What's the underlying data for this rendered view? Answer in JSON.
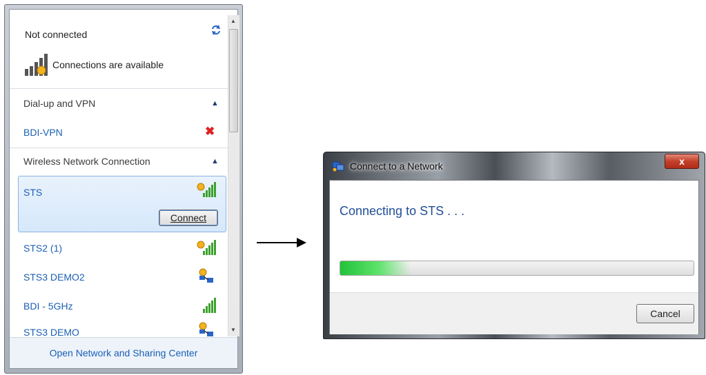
{
  "flyout": {
    "status_title": "Not connected",
    "status_subtitle": "Connections are available",
    "sections": {
      "dialup": {
        "label": "Dial-up and VPN",
        "items": [
          {
            "name": "BDI-VPN",
            "icon": "red-x-icon"
          }
        ]
      },
      "wireless": {
        "label": "Wireless Network Connection",
        "items": [
          {
            "name": "STS",
            "icon": "wifi-signal-icon",
            "selected": true
          },
          {
            "name": "STS2 (1)",
            "icon": "wifi-signal-icon"
          },
          {
            "name": "STS3 DEMO2",
            "icon": "adhoc-network-icon"
          },
          {
            "name": "BDI - 5GHz",
            "icon": "wifi-signal-icon"
          },
          {
            "name": "STS3 DEMO",
            "icon": "adhoc-network-icon"
          }
        ]
      }
    },
    "connect_label": "Connect",
    "footer_link": "Open Network and Sharing Center"
  },
  "dialog": {
    "title": "Connect to a Network",
    "close_label": "x",
    "message": "Connecting to STS . . .",
    "progress": 0.2,
    "cancel_label": "Cancel"
  },
  "colors": {
    "link_blue": "#1a5fb4",
    "progress_green": "#22c23a",
    "close_red": "#c2402a"
  }
}
